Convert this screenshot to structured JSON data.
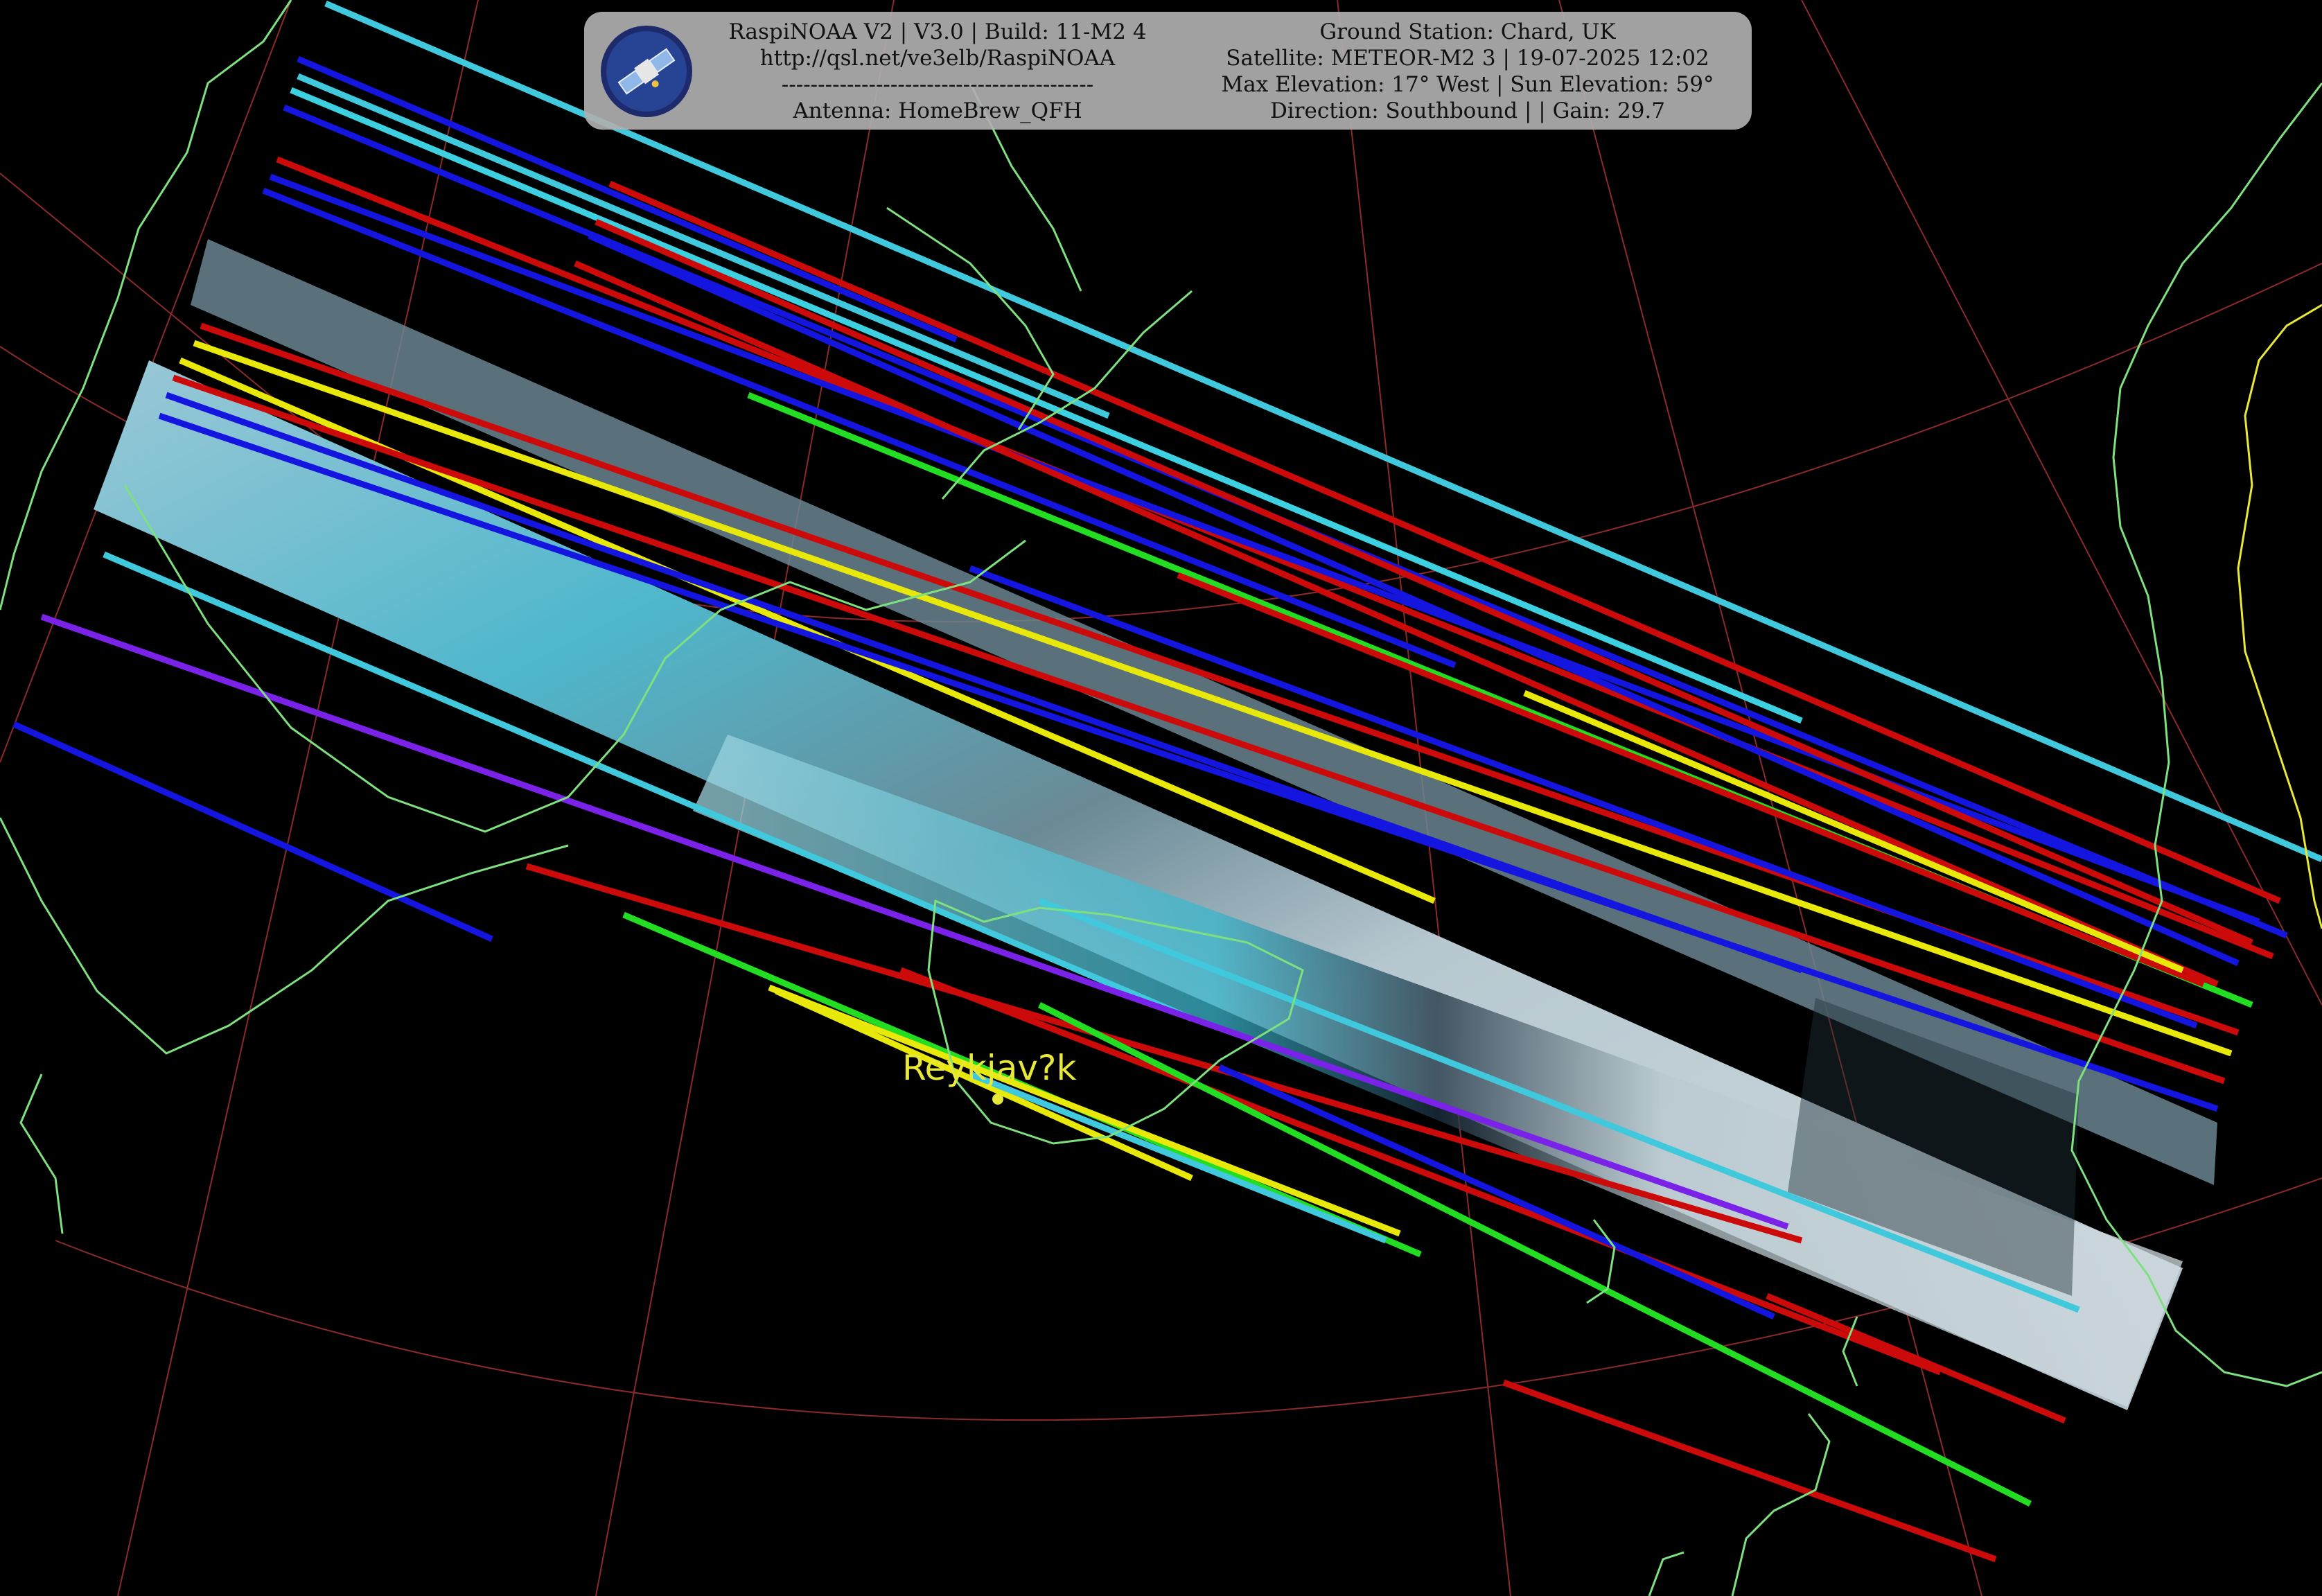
{
  "header": {
    "left": {
      "line1": "RaspiNOAA V2 | V3.0 | Build: 11-M2 4",
      "line2": "http://qsl.net/ve3elb/RaspiNOAA",
      "line3": "-------------------------------------------",
      "line4": "Antenna: HomeBrew_QFH"
    },
    "right": {
      "line1": "Ground Station: Chard, UK",
      "line2": "Satellite: METEOR-M2 3 | 19-07-2025 12:02",
      "line3": "Max Elevation: 17° West | Sun Elevation: 59°",
      "line4": "Direction: Southbound | | Gain: 29.7"
    },
    "logo_icon": "satellite-icon"
  },
  "map": {
    "city_label": "Reykjav?k",
    "colors": {
      "coastline": "#7ee07e",
      "border": "#e8e838",
      "graticule": "#8b2a2a",
      "city": "#e8e838",
      "panel_bg": "#afafaf",
      "background": "#000000"
    }
  }
}
